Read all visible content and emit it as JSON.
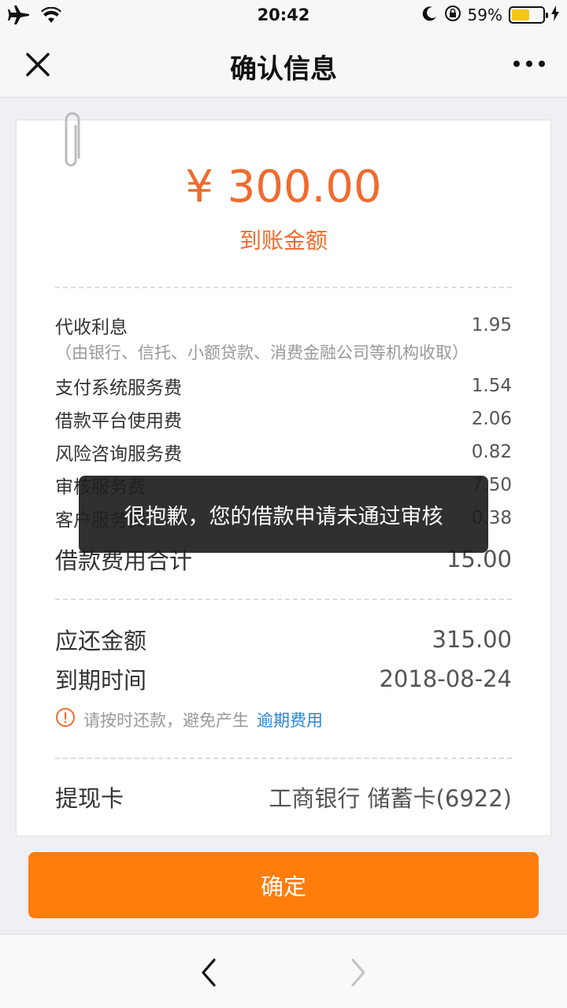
{
  "status_bar": {
    "time": "20:42",
    "battery": "59%",
    "battery_level": 0.59
  },
  "nav": {
    "title": "确认信息"
  },
  "amount": {
    "value": "¥ 300.00",
    "label": "到账金额"
  },
  "fees": {
    "interest": {
      "label": "代收利息",
      "value": "1.95"
    },
    "interest_note": "（由银行、信托、小额贷款、消费金融公司等机构收取）",
    "payment_service": {
      "label": "支付系统服务费",
      "value": "1.54"
    },
    "platform_fee": {
      "label": "借款平台使用费",
      "value": "2.06"
    },
    "risk_consult": {
      "label": "风险咨询服务费",
      "value": "0.82"
    },
    "audit_service": {
      "label": "审核服务费",
      "value": "7.50"
    },
    "customer_service": {
      "label": "客户服务费",
      "value": "0.38"
    },
    "total": {
      "label": "借款费用合计",
      "value": "15.00"
    }
  },
  "repayment": {
    "amount": {
      "label": "应还金额",
      "value": "315.00"
    },
    "due_date": {
      "label": "到期时间",
      "value": "2018-08-24"
    },
    "warning_text": "请按时还款，避免产生",
    "warning_link": "逾期费用"
  },
  "card_row": {
    "label": "提现卡",
    "value": "工商银行 储蓄卡(6922)"
  },
  "toast": "很抱歉，您的借款申请未通过审核",
  "confirm_button": "确定",
  "colors": {
    "accent": "#ff7d0d",
    "amount": "#f06b2e",
    "link": "#2a86d6"
  }
}
